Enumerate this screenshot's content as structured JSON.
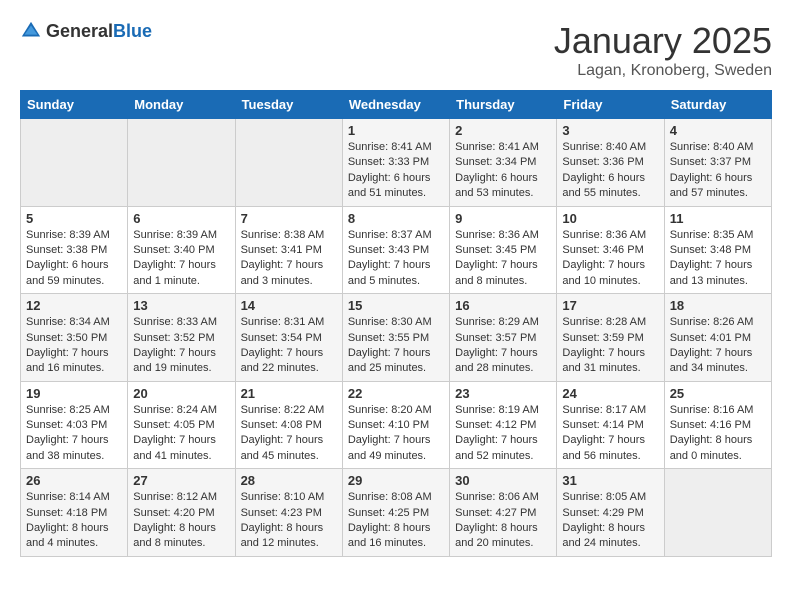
{
  "header": {
    "logo_general": "General",
    "logo_blue": "Blue",
    "month": "January 2025",
    "location": "Lagan, Kronoberg, Sweden"
  },
  "days_of_week": [
    "Sunday",
    "Monday",
    "Tuesday",
    "Wednesday",
    "Thursday",
    "Friday",
    "Saturday"
  ],
  "weeks": [
    [
      {
        "day": "",
        "info": ""
      },
      {
        "day": "",
        "info": ""
      },
      {
        "day": "",
        "info": ""
      },
      {
        "day": "1",
        "info": "Sunrise: 8:41 AM\nSunset: 3:33 PM\nDaylight: 6 hours\nand 51 minutes."
      },
      {
        "day": "2",
        "info": "Sunrise: 8:41 AM\nSunset: 3:34 PM\nDaylight: 6 hours\nand 53 minutes."
      },
      {
        "day": "3",
        "info": "Sunrise: 8:40 AM\nSunset: 3:36 PM\nDaylight: 6 hours\nand 55 minutes."
      },
      {
        "day": "4",
        "info": "Sunrise: 8:40 AM\nSunset: 3:37 PM\nDaylight: 6 hours\nand 57 minutes."
      }
    ],
    [
      {
        "day": "5",
        "info": "Sunrise: 8:39 AM\nSunset: 3:38 PM\nDaylight: 6 hours\nand 59 minutes."
      },
      {
        "day": "6",
        "info": "Sunrise: 8:39 AM\nSunset: 3:40 PM\nDaylight: 7 hours\nand 1 minute."
      },
      {
        "day": "7",
        "info": "Sunrise: 8:38 AM\nSunset: 3:41 PM\nDaylight: 7 hours\nand 3 minutes."
      },
      {
        "day": "8",
        "info": "Sunrise: 8:37 AM\nSunset: 3:43 PM\nDaylight: 7 hours\nand 5 minutes."
      },
      {
        "day": "9",
        "info": "Sunrise: 8:36 AM\nSunset: 3:45 PM\nDaylight: 7 hours\nand 8 minutes."
      },
      {
        "day": "10",
        "info": "Sunrise: 8:36 AM\nSunset: 3:46 PM\nDaylight: 7 hours\nand 10 minutes."
      },
      {
        "day": "11",
        "info": "Sunrise: 8:35 AM\nSunset: 3:48 PM\nDaylight: 7 hours\nand 13 minutes."
      }
    ],
    [
      {
        "day": "12",
        "info": "Sunrise: 8:34 AM\nSunset: 3:50 PM\nDaylight: 7 hours\nand 16 minutes."
      },
      {
        "day": "13",
        "info": "Sunrise: 8:33 AM\nSunset: 3:52 PM\nDaylight: 7 hours\nand 19 minutes."
      },
      {
        "day": "14",
        "info": "Sunrise: 8:31 AM\nSunset: 3:54 PM\nDaylight: 7 hours\nand 22 minutes."
      },
      {
        "day": "15",
        "info": "Sunrise: 8:30 AM\nSunset: 3:55 PM\nDaylight: 7 hours\nand 25 minutes."
      },
      {
        "day": "16",
        "info": "Sunrise: 8:29 AM\nSunset: 3:57 PM\nDaylight: 7 hours\nand 28 minutes."
      },
      {
        "day": "17",
        "info": "Sunrise: 8:28 AM\nSunset: 3:59 PM\nDaylight: 7 hours\nand 31 minutes."
      },
      {
        "day": "18",
        "info": "Sunrise: 8:26 AM\nSunset: 4:01 PM\nDaylight: 7 hours\nand 34 minutes."
      }
    ],
    [
      {
        "day": "19",
        "info": "Sunrise: 8:25 AM\nSunset: 4:03 PM\nDaylight: 7 hours\nand 38 minutes."
      },
      {
        "day": "20",
        "info": "Sunrise: 8:24 AM\nSunset: 4:05 PM\nDaylight: 7 hours\nand 41 minutes."
      },
      {
        "day": "21",
        "info": "Sunrise: 8:22 AM\nSunset: 4:08 PM\nDaylight: 7 hours\nand 45 minutes."
      },
      {
        "day": "22",
        "info": "Sunrise: 8:20 AM\nSunset: 4:10 PM\nDaylight: 7 hours\nand 49 minutes."
      },
      {
        "day": "23",
        "info": "Sunrise: 8:19 AM\nSunset: 4:12 PM\nDaylight: 7 hours\nand 52 minutes."
      },
      {
        "day": "24",
        "info": "Sunrise: 8:17 AM\nSunset: 4:14 PM\nDaylight: 7 hours\nand 56 minutes."
      },
      {
        "day": "25",
        "info": "Sunrise: 8:16 AM\nSunset: 4:16 PM\nDaylight: 8 hours\nand 0 minutes."
      }
    ],
    [
      {
        "day": "26",
        "info": "Sunrise: 8:14 AM\nSunset: 4:18 PM\nDaylight: 8 hours\nand 4 minutes."
      },
      {
        "day": "27",
        "info": "Sunrise: 8:12 AM\nSunset: 4:20 PM\nDaylight: 8 hours\nand 8 minutes."
      },
      {
        "day": "28",
        "info": "Sunrise: 8:10 AM\nSunset: 4:23 PM\nDaylight: 8 hours\nand 12 minutes."
      },
      {
        "day": "29",
        "info": "Sunrise: 8:08 AM\nSunset: 4:25 PM\nDaylight: 8 hours\nand 16 minutes."
      },
      {
        "day": "30",
        "info": "Sunrise: 8:06 AM\nSunset: 4:27 PM\nDaylight: 8 hours\nand 20 minutes."
      },
      {
        "day": "31",
        "info": "Sunrise: 8:05 AM\nSunset: 4:29 PM\nDaylight: 8 hours\nand 24 minutes."
      },
      {
        "day": "",
        "info": ""
      }
    ]
  ]
}
